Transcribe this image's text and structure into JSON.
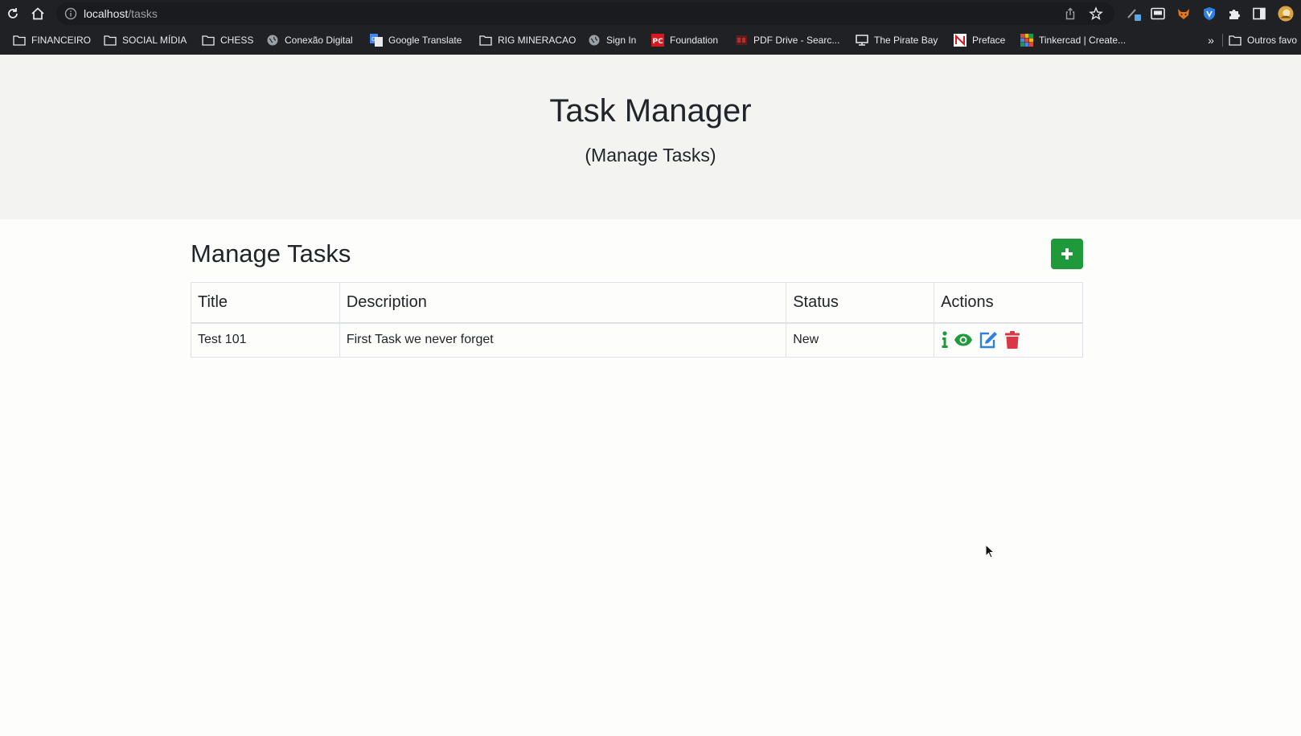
{
  "browser": {
    "url_host": "localhost",
    "url_path": "/tasks",
    "bookmarks": [
      {
        "label": "FINANCEIRO",
        "icon": "folder-icon"
      },
      {
        "label": "SOCIAL MÍDIA",
        "icon": "folder-icon"
      },
      {
        "label": "CHESS",
        "icon": "folder-icon"
      },
      {
        "label": "Conexão Digital",
        "icon": "globe-icon"
      },
      {
        "label": "Google Translate",
        "icon": "translate-icon"
      },
      {
        "label": "RIG MINERACAO",
        "icon": "folder-icon"
      },
      {
        "label": "Sign In",
        "icon": "globe-icon"
      },
      {
        "label": "Foundation",
        "icon": "pc-icon"
      },
      {
        "label": "PDF Drive - Searc...",
        "icon": "pdf-icon"
      },
      {
        "label": "The Pirate Bay",
        "icon": "monitor-icon"
      },
      {
        "label": "Preface",
        "icon": "n-icon"
      },
      {
        "label": "Tinkercad | Create...",
        "icon": "grid-icon"
      }
    ],
    "other_bookmarks": "Outros favo"
  },
  "header": {
    "title": "Task Manager",
    "subtitle": "(Manage Tasks)"
  },
  "main": {
    "heading": "Manage Tasks",
    "add_button_icon": "plus-icon",
    "table": {
      "columns": [
        "Title",
        "Description",
        "Status",
        "Actions"
      ],
      "rows": [
        {
          "title": "Test 101",
          "description": "First Task we never forget",
          "status": "New"
        }
      ]
    }
  },
  "colors": {
    "success": "#1f9a3b",
    "primary": "#2f80e4",
    "danger": "#dc3545"
  }
}
